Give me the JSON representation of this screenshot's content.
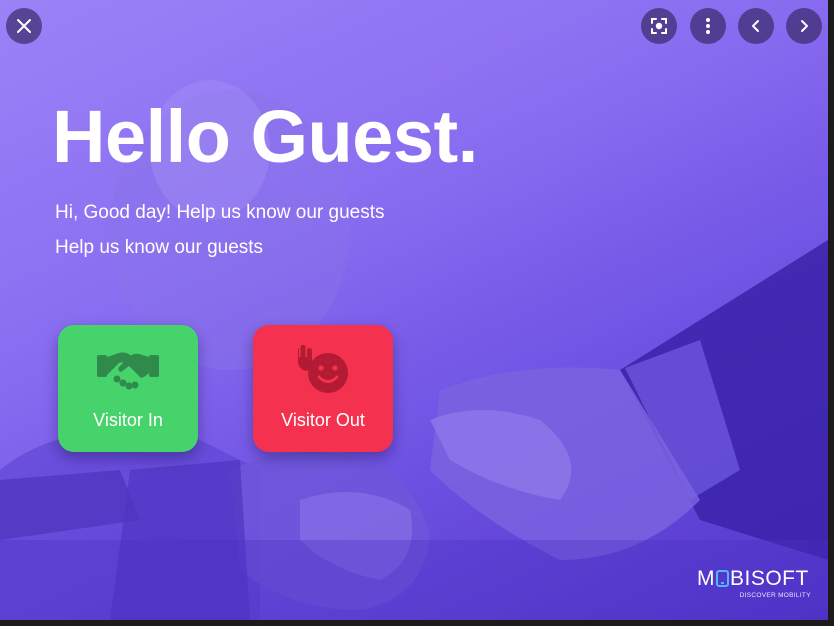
{
  "viewer": {
    "controls": {
      "close": "close",
      "lens": "visual-search",
      "more": "more-options",
      "previous": "previous",
      "next": "next"
    }
  },
  "hero": {
    "title": "Hello Guest.",
    "subtitle_1": "Hi, Good day! Help us know our guests",
    "subtitle_2": "Help us know our guests"
  },
  "actions": {
    "visitor_in": {
      "label": "Visitor In",
      "icon": "handshake-icon",
      "color": "#47d36b"
    },
    "visitor_out": {
      "label": "Visitor Out",
      "icon": "waving-smiley-icon",
      "color": "#f4324f"
    }
  },
  "brand": {
    "name_start": "M",
    "name_end": "BISOFT",
    "tagline": "DISCOVER MOBILITY"
  },
  "colors": {
    "overlay": "#8a6ef1",
    "accent": "#4fb6ff"
  }
}
